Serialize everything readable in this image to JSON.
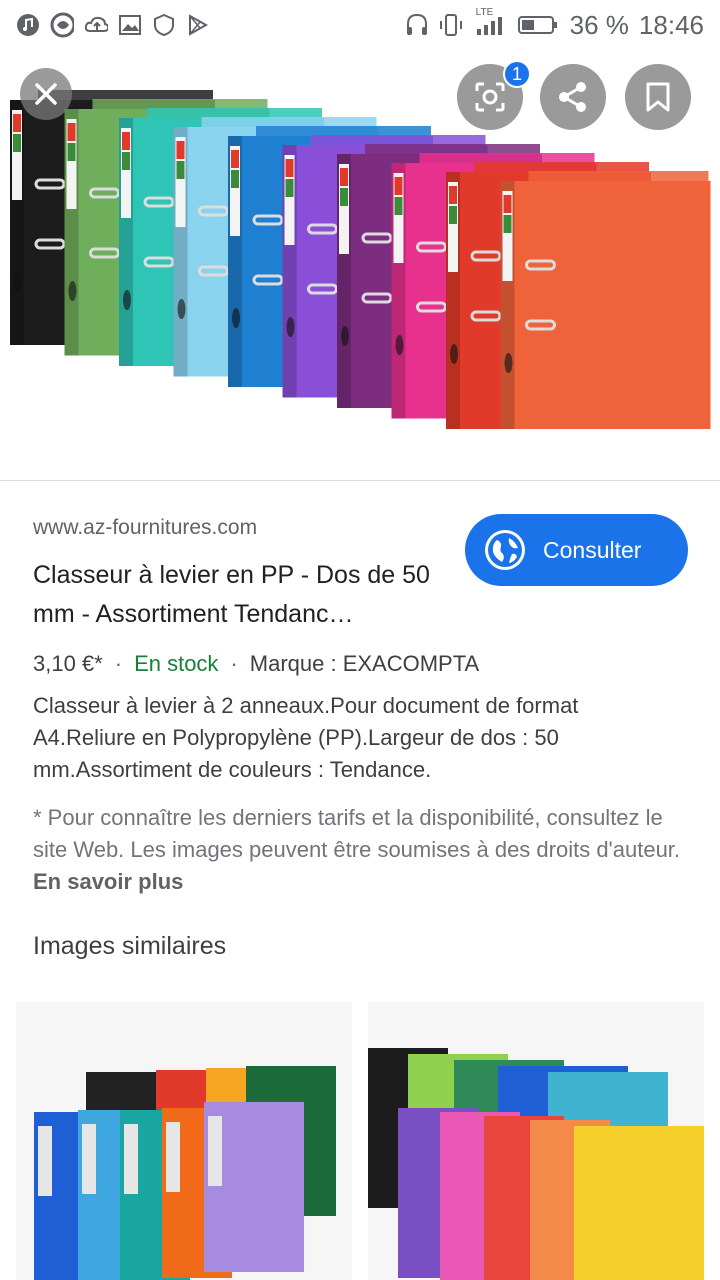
{
  "status_bar": {
    "network": "LTE",
    "battery": "36 %",
    "time": "18:46"
  },
  "hero": {
    "lens_badge": "1",
    "binder_colors": [
      "#1c1c1c",
      "#6fae5a",
      "#2ec4b6",
      "#8ad3ef",
      "#1f7fd0",
      "#8a4fd8",
      "#7d2d7f",
      "#e8308d",
      "#e23a2a",
      "#f0623a"
    ]
  },
  "result": {
    "site": "www.az-fournitures.com",
    "title": "Classeur à levier en PP - Dos de 50 mm - Assortiment Tendanc…",
    "consult_label": "Consulter",
    "price": "3,10 €*",
    "stock": "En stock",
    "brand": "Marque : EXACOMPTA",
    "description": "Classeur à levier à 2 anneaux.Pour document de format A4.Reliure en Polypropylène (PP).Largeur de dos : 50 mm.Assortiment de couleurs : Tendance.",
    "disclaimer": "* Pour connaître les derniers tarifs et la disponibilité, consultez le site Web. Les images peuvent être soumises à des droits d'auteur.",
    "learn_more": "En savoir plus"
  },
  "similar": {
    "title": "Images similaires"
  },
  "colors": {
    "accent": "#1a73e8",
    "stock_green": "#188038"
  }
}
